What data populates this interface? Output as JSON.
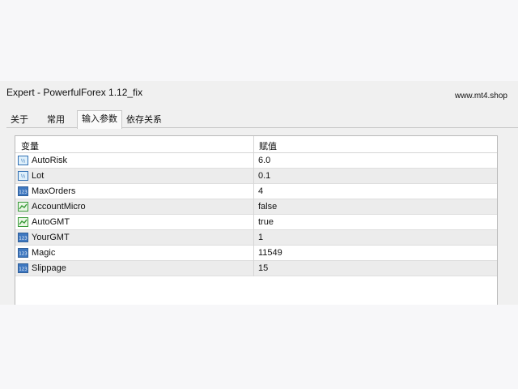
{
  "window": {
    "title": "Expert - PowerfulForex 1.12_fix",
    "watermark": "www.mt4.shop"
  },
  "tabs": [
    {
      "label": "关于"
    },
    {
      "label": "常用"
    },
    {
      "label": "输入参数",
      "active": true
    },
    {
      "label": "依存关系"
    }
  ],
  "table": {
    "headers": {
      "variable": "变量",
      "value": "赋值"
    },
    "rows": [
      {
        "icon": "double-type-icon",
        "name": "AutoRisk",
        "value": "6.0"
      },
      {
        "icon": "double-type-icon",
        "name": "Lot",
        "value": "0.1"
      },
      {
        "icon": "integer-type-icon",
        "name": "MaxOrders",
        "value": "4"
      },
      {
        "icon": "boolean-type-icon",
        "name": "AccountMicro",
        "value": "false"
      },
      {
        "icon": "boolean-type-icon",
        "name": "AutoGMT",
        "value": "true"
      },
      {
        "icon": "integer-type-icon",
        "name": "YourGMT",
        "value": "1"
      },
      {
        "icon": "integer-type-icon",
        "name": "Magic",
        "value": "11549"
      },
      {
        "icon": "integer-type-icon",
        "name": "Slippage",
        "value": "15"
      }
    ]
  },
  "colors": {
    "row_alt": "#ececec",
    "icon_blue": "#2f6fb3",
    "icon_green": "#3a9b3a"
  }
}
